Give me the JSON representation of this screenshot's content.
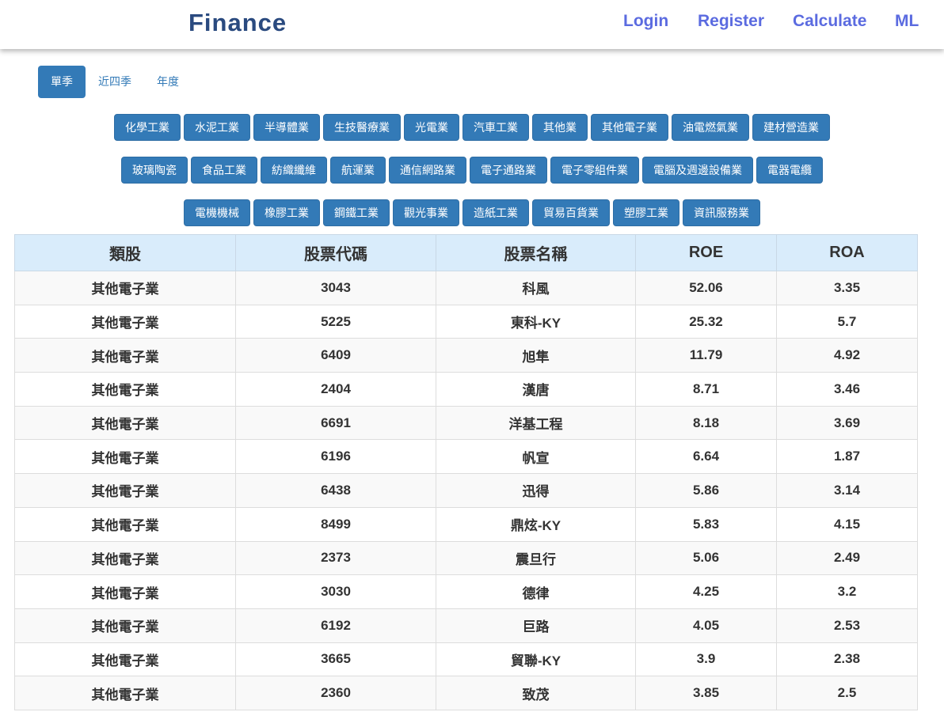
{
  "navbar": {
    "brand": "Finance",
    "links": [
      "Login",
      "Register",
      "Calculate",
      "ML"
    ]
  },
  "period_tabs": [
    {
      "label": "單季",
      "active": true
    },
    {
      "label": "近四季",
      "active": false
    },
    {
      "label": "年度",
      "active": false
    }
  ],
  "industries": [
    [
      "化學工業",
      "水泥工業",
      "半導體業",
      "生技醫療業",
      "光電業",
      "汽車工業",
      "其他業",
      "其他電子業",
      "油電燃氣業",
      "建材營造業"
    ],
    [
      "玻璃陶瓷",
      "食品工業",
      "紡織纖維",
      "航運業",
      "通信網路業",
      "電子通路業",
      "電子零組件業",
      "電腦及週邊設備業",
      "電器電纜"
    ],
    [
      "電機機械",
      "橡膠工業",
      "鋼鐵工業",
      "觀光事業",
      "造紙工業",
      "貿易百貨業",
      "塑膠工業",
      "資訊服務業"
    ]
  ],
  "table": {
    "headers": [
      "類股",
      "股票代碼",
      "股票名稱",
      "ROE",
      "ROA"
    ],
    "rows": [
      [
        "其他電子業",
        "3043",
        "科風",
        "52.06",
        "3.35"
      ],
      [
        "其他電子業",
        "5225",
        "東科-KY",
        "25.32",
        "5.7"
      ],
      [
        "其他電子業",
        "6409",
        "旭隼",
        "11.79",
        "4.92"
      ],
      [
        "其他電子業",
        "2404",
        "漢唐",
        "8.71",
        "3.46"
      ],
      [
        "其他電子業",
        "6691",
        "洋基工程",
        "8.18",
        "3.69"
      ],
      [
        "其他電子業",
        "6196",
        "帆宣",
        "6.64",
        "1.87"
      ],
      [
        "其他電子業",
        "6438",
        "迅得",
        "5.86",
        "3.14"
      ],
      [
        "其他電子業",
        "8499",
        "鼎炫-KY",
        "5.83",
        "4.15"
      ],
      [
        "其他電子業",
        "2373",
        "震旦行",
        "5.06",
        "2.49"
      ],
      [
        "其他電子業",
        "3030",
        "德律",
        "4.25",
        "3.2"
      ],
      [
        "其他電子業",
        "6192",
        "巨路",
        "4.05",
        "2.53"
      ],
      [
        "其他電子業",
        "3665",
        "貿聯-KY",
        "3.9",
        "2.38"
      ],
      [
        "其他電子業",
        "2360",
        "致茂",
        "3.85",
        "2.5"
      ]
    ]
  },
  "colors": {
    "brand": "#2a4a7f",
    "nav_link": "#5b6be0",
    "button": "#337ab7",
    "table_header": "#d9ecfb"
  }
}
